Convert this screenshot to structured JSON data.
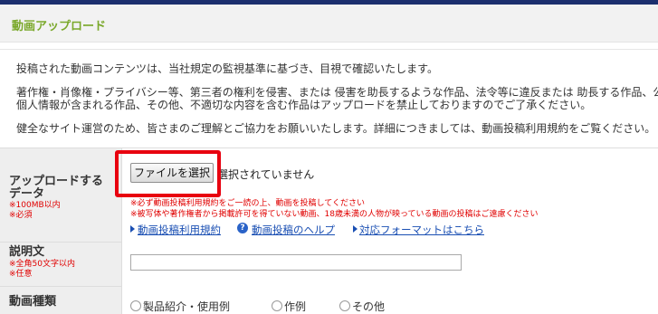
{
  "header": {
    "title": "動画アップロード"
  },
  "notice": {
    "line1": "投稿された動画コンテンツは、当社規定の監視基準に基づき、目視で確認いたします。",
    "line2": "著作権・肖像権・プライバシー等、第三者の権利を侵害、または 侵害を助長するような作品、法令等に違反または 助長する作品、公序",
    "line3": "個人情報が含まれる作品、その他、不適切な内容を含む作品はアップロードを禁止しておりますのでご了承ください。",
    "line4": "健全なサイト運営のため、皆さまのご理解とご協力をお願いいたします。詳細につきましては、動画投稿利用規約をご覧ください。"
  },
  "upload": {
    "label_line1": "アップロードする",
    "label_line2": "データ",
    "limit": "※100MB以内",
    "required": "※必須",
    "file_button": "ファイルを選択",
    "file_status": "選択されていません",
    "warning1": "※必ず動画投稿利用規約をご一読の上、動画を投稿してください",
    "warning2": "※被写体や著作権者から掲載許可を得ていない動画、18歳未満の人物が映っている動画の投稿はご遠慮ください",
    "link_terms": "動画投稿利用規約",
    "link_help": "動画投稿のヘルプ",
    "link_formats": "対応フォーマットはこちら"
  },
  "description": {
    "label": "説明文",
    "limit": "※全角50文字以内",
    "optional": "※任意",
    "value": ""
  },
  "video_type": {
    "label": "動画種類",
    "options": [
      "製品紹介・使用例",
      "作例",
      "その他"
    ]
  }
}
